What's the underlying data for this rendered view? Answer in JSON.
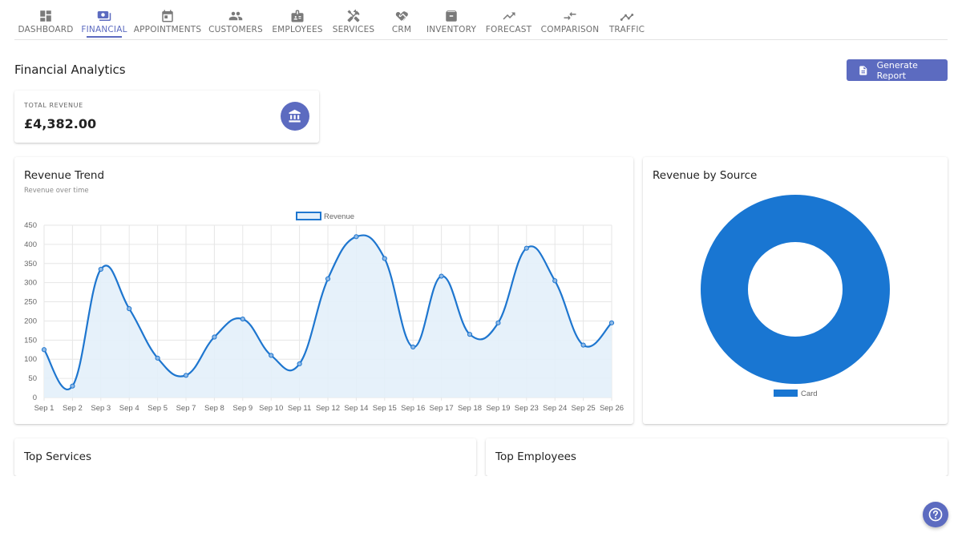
{
  "nav": {
    "tabs": [
      {
        "label": "DASHBOARD",
        "icon": "dashboard-icon",
        "active": false
      },
      {
        "label": "FINANCIAL",
        "icon": "payments-icon",
        "active": true
      },
      {
        "label": "APPOINTMENTS",
        "icon": "calendar-icon",
        "active": false
      },
      {
        "label": "CUSTOMERS",
        "icon": "people-icon",
        "active": false
      },
      {
        "label": "EMPLOYEES",
        "icon": "badge-icon",
        "active": false
      },
      {
        "label": "SERVICES",
        "icon": "tools-icon",
        "active": false
      },
      {
        "label": "CRM",
        "icon": "handshake-icon",
        "active": false
      },
      {
        "label": "INVENTORY",
        "icon": "archive-icon",
        "active": false
      },
      {
        "label": "FORECAST",
        "icon": "trending-up-icon",
        "active": false
      },
      {
        "label": "COMPARISON",
        "icon": "compare-arrows-icon",
        "active": false
      },
      {
        "label": "TRAFFIC",
        "icon": "insights-icon",
        "active": false
      }
    ]
  },
  "header": {
    "title": "Financial Analytics",
    "generate_label": "Generate Report"
  },
  "stat": {
    "label": "TOTAL REVENUE",
    "value": "£4,382.00"
  },
  "trend": {
    "title": "Revenue Trend",
    "subtitle": "Revenue over time"
  },
  "source": {
    "title": "Revenue by Source"
  },
  "sections": {
    "top_services": "Top Services",
    "top_employees": "Top Employees"
  },
  "colors": {
    "accent": "#5c6bc0",
    "line": "#1e76cf",
    "area": "#e3effa",
    "donut": "#1976d2"
  },
  "chart_data": [
    {
      "type": "line",
      "x": [
        "Sep 1",
        "Sep 2",
        "Sep 3",
        "Sep 4",
        "Sep 5",
        "Sep 7",
        "Sep 8",
        "Sep 9",
        "Sep 10",
        "Sep 11",
        "Sep 12",
        "Sep 14",
        "Sep 15",
        "Sep 16",
        "Sep 17",
        "Sep 18",
        "Sep 19",
        "Sep 23",
        "Sep 24",
        "Sep 25",
        "Sep 26"
      ],
      "series": [
        {
          "name": "Revenue",
          "values": [
            125,
            30,
            335,
            232,
            103,
            58,
            158,
            205,
            110,
            88,
            310,
            420,
            363,
            132,
            317,
            165,
            195,
            390,
            305,
            137,
            195
          ]
        }
      ],
      "ylim": [
        0,
        450
      ],
      "yticks": [
        0,
        50,
        100,
        150,
        200,
        250,
        300,
        350,
        400,
        450
      ],
      "legend": "top-center",
      "grid": true,
      "fill": true
    },
    {
      "type": "pie",
      "categories": [
        "Card"
      ],
      "values": [
        4382
      ],
      "donut": true,
      "legend": "bottom-center"
    }
  ]
}
